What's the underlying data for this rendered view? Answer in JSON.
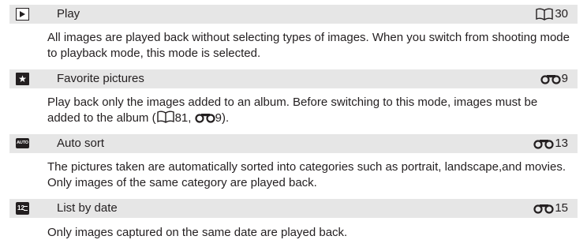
{
  "modes": [
    {
      "icon": "play-icon",
      "title": "Play",
      "ref_type": "book",
      "ref_page": "30",
      "description": "All images are played back without selecting types of images. When you switch from shooting mode to playback mode, this mode is selected."
    },
    {
      "icon": "favorite-star-icon",
      "title": "Favorite pictures",
      "ref_type": "link",
      "ref_page": "9",
      "description_part1": "Play back only the images added to an album. Before switching to this mode, images must be added to the album (",
      "description_ref1": "81, ",
      "description_ref2": "9",
      "description_part2": ")."
    },
    {
      "icon": "auto-sort-icon",
      "title": "Auto sort",
      "ref_type": "link",
      "ref_page": "13",
      "description": "The pictures taken are automatically sorted into categories such as portrait, landscape,and movies. Only images of the same category are played back."
    },
    {
      "icon": "list-by-date-icon",
      "title": "List by date",
      "ref_type": "link",
      "ref_page": "15",
      "description": "Only images captured on the same date are played back."
    }
  ]
}
